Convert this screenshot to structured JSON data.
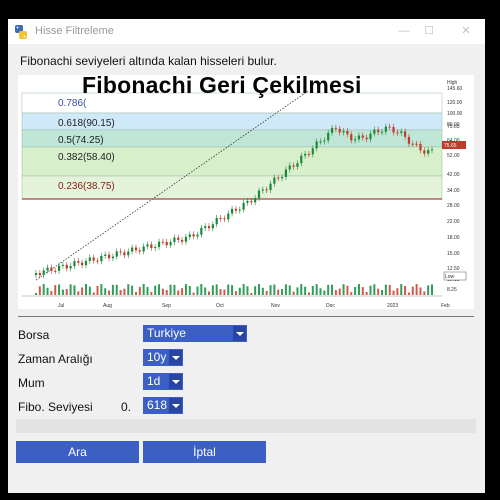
{
  "window": {
    "title": "Hisse Filtreleme",
    "min_glyph": "—",
    "max_glyph": "☐",
    "close_glyph": "✕"
  },
  "description": "Fibonachi seviyeleri altında kalan hisseleri bulur.",
  "chart_overlay_title": "Fibonachi Geri Çekilmesi",
  "chart_data": {
    "type": "candlestick",
    "fib_levels": [
      {
        "label": "0.786(",
        "value": 0.786,
        "band_color": "#ffffff",
        "text_color": "#3a4fb0"
      },
      {
        "label": "0.618(90.15)",
        "value": 90.15,
        "band_color": "#cfe9f8",
        "text_color": "#222222"
      },
      {
        "label": "0.5(74.25)",
        "value": 74.25,
        "band_color": "#bfe6d6",
        "text_color": "#222222"
      },
      {
        "label": "0.382(58.40)",
        "value": 58.4,
        "band_color": "#d8efcc",
        "text_color": "#222222"
      },
      {
        "label": "0.236(38.75)",
        "value": 38.75,
        "band_color": "#e3f4da",
        "text_color": "#8b1a1a"
      }
    ],
    "y_ticks": [
      "High",
      "145.60",
      "120.00",
      "100.00",
      "80.00",
      "75.65",
      "64.00",
      "52.00",
      "42.00",
      "34.00",
      "28.00",
      "22.00",
      "18.00",
      "15.00",
      "12.50",
      "10.15",
      "8.25"
    ],
    "x_ticks": [
      "Jul",
      "Aug",
      "Sep",
      "Oct",
      "Nov",
      "Dec",
      "2023",
      "Feb"
    ],
    "low_label": "Low",
    "low_value": "10.15",
    "last_value": "75.65"
  },
  "form": {
    "borsa": {
      "label": "Borsa",
      "value": "Turkiye"
    },
    "zaman": {
      "label": "Zaman Aralığı",
      "value": "10y"
    },
    "mum": {
      "label": "Mum",
      "value": "1d"
    },
    "fibo": {
      "label": "Fibo. Seviyesi",
      "prefix": "0.",
      "value": "618"
    }
  },
  "buttons": {
    "search": "Ara",
    "cancel": "İptal"
  },
  "colors": {
    "button": "#3c5fc4",
    "up_candle": "#1a8a3a",
    "down_candle": "#c0392b"
  }
}
